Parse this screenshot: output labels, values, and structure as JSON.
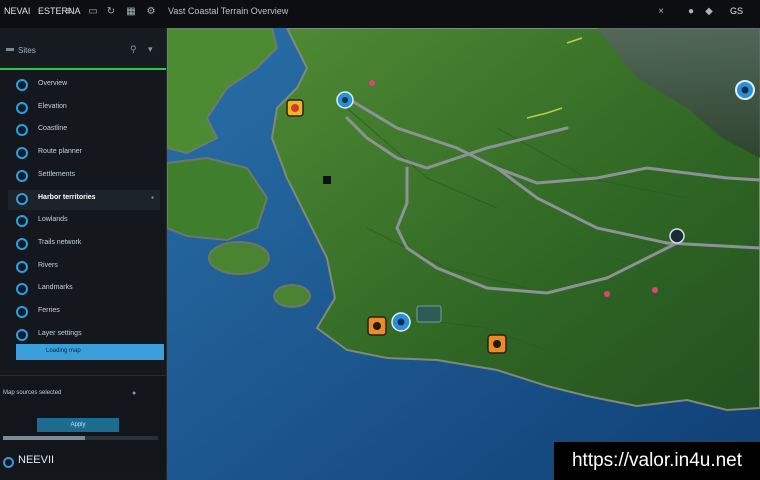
{
  "topbar": {
    "title_left": "NEVAI",
    "title_left2": "ESTERNA",
    "center": "Vast Coastal Terrain Overview",
    "right": "GS"
  },
  "sidebar": {
    "header_title": "Sites",
    "items": [
      {
        "label": "Overview",
        "active": false
      },
      {
        "label": "Elevation",
        "active": false
      },
      {
        "label": "Coastline",
        "active": false
      },
      {
        "label": "Route planner",
        "active": false
      },
      {
        "label": "Settlements",
        "active": false
      },
      {
        "label": "Harbor territories",
        "active": true
      },
      {
        "label": "Lowlands",
        "active": false
      },
      {
        "label": "Trails network",
        "active": false
      },
      {
        "label": "Rivers",
        "active": false
      },
      {
        "label": "Landmarks",
        "active": false
      },
      {
        "label": "Ferries",
        "active": false
      },
      {
        "label": "Layer settings",
        "active": false
      }
    ],
    "progress_label": "Loading map",
    "progress_fraction": 1
  },
  "lower_panel": {
    "line1": "Map sources selected",
    "button": "Apply",
    "bar_fraction": 0.53
  },
  "brand": "NEEVII",
  "watermark": "https://valor.in4u.net",
  "colors": {
    "accent_green": "#28c94a",
    "accent_blue": "#2d9cdb",
    "water": "#1f5f95",
    "land": "#3f7a2c"
  },
  "map_markers": [
    {
      "icon": "orange-location-marker"
    },
    {
      "icon": "blue-location-marker"
    },
    {
      "icon": "dark-pin-marker"
    }
  ]
}
